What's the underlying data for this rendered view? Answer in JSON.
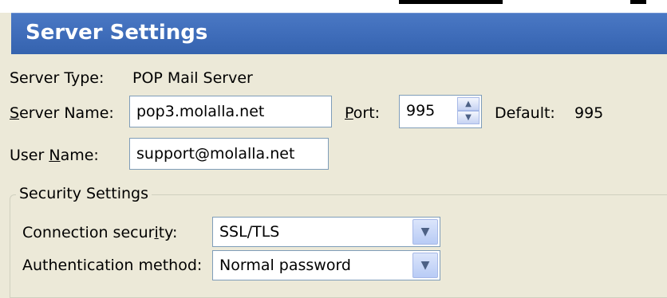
{
  "header": {
    "title": "Server Settings"
  },
  "server_type": {
    "label": "Server Type:",
    "value": "POP Mail Server"
  },
  "server_name": {
    "label_prefix": "",
    "label_key": "S",
    "label_rest": "erver Name:",
    "value": "pop3.molalla.net"
  },
  "port": {
    "label_key": "P",
    "label_rest": "ort:",
    "value": "995",
    "default_label": "Default:",
    "default_value": "995"
  },
  "user_name": {
    "label_prefix": "User ",
    "label_key": "N",
    "label_rest": "ame:",
    "value": "support@molalla.net"
  },
  "security": {
    "legend": "Security Settings",
    "connection": {
      "label_prefix": "Connection secur",
      "label_key": "i",
      "label_rest": "ty:",
      "value": "SSL/TLS"
    },
    "authentication": {
      "label_prefix": "Authentication method:",
      "value": "Normal password"
    }
  }
}
